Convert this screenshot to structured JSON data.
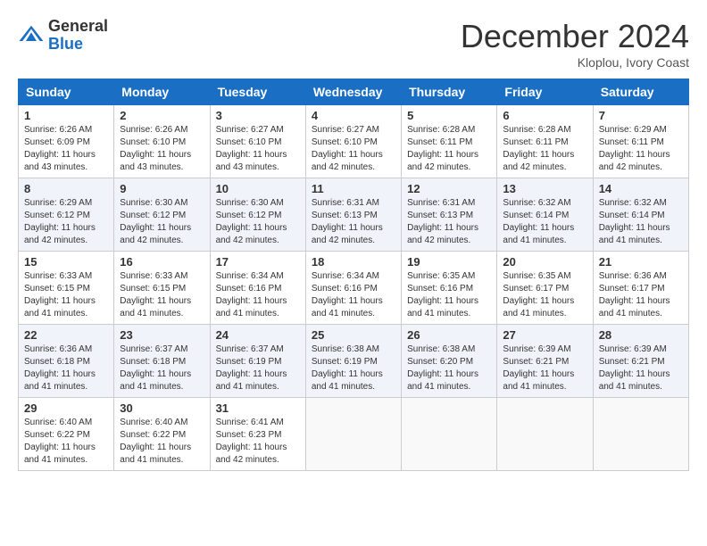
{
  "logo": {
    "general": "General",
    "blue": "Blue"
  },
  "title": "December 2024",
  "location": "Kloplou, Ivory Coast",
  "days_header": [
    "Sunday",
    "Monday",
    "Tuesday",
    "Wednesday",
    "Thursday",
    "Friday",
    "Saturday"
  ],
  "weeks": [
    [
      {
        "day": "1",
        "info": "Sunrise: 6:26 AM\nSunset: 6:09 PM\nDaylight: 11 hours and 43 minutes."
      },
      {
        "day": "2",
        "info": "Sunrise: 6:26 AM\nSunset: 6:10 PM\nDaylight: 11 hours and 43 minutes."
      },
      {
        "day": "3",
        "info": "Sunrise: 6:27 AM\nSunset: 6:10 PM\nDaylight: 11 hours and 43 minutes."
      },
      {
        "day": "4",
        "info": "Sunrise: 6:27 AM\nSunset: 6:10 PM\nDaylight: 11 hours and 42 minutes."
      },
      {
        "day": "5",
        "info": "Sunrise: 6:28 AM\nSunset: 6:11 PM\nDaylight: 11 hours and 42 minutes."
      },
      {
        "day": "6",
        "info": "Sunrise: 6:28 AM\nSunset: 6:11 PM\nDaylight: 11 hours and 42 minutes."
      },
      {
        "day": "7",
        "info": "Sunrise: 6:29 AM\nSunset: 6:11 PM\nDaylight: 11 hours and 42 minutes."
      }
    ],
    [
      {
        "day": "8",
        "info": "Sunrise: 6:29 AM\nSunset: 6:12 PM\nDaylight: 11 hours and 42 minutes."
      },
      {
        "day": "9",
        "info": "Sunrise: 6:30 AM\nSunset: 6:12 PM\nDaylight: 11 hours and 42 minutes."
      },
      {
        "day": "10",
        "info": "Sunrise: 6:30 AM\nSunset: 6:12 PM\nDaylight: 11 hours and 42 minutes."
      },
      {
        "day": "11",
        "info": "Sunrise: 6:31 AM\nSunset: 6:13 PM\nDaylight: 11 hours and 42 minutes."
      },
      {
        "day": "12",
        "info": "Sunrise: 6:31 AM\nSunset: 6:13 PM\nDaylight: 11 hours and 42 minutes."
      },
      {
        "day": "13",
        "info": "Sunrise: 6:32 AM\nSunset: 6:14 PM\nDaylight: 11 hours and 41 minutes."
      },
      {
        "day": "14",
        "info": "Sunrise: 6:32 AM\nSunset: 6:14 PM\nDaylight: 11 hours and 41 minutes."
      }
    ],
    [
      {
        "day": "15",
        "info": "Sunrise: 6:33 AM\nSunset: 6:15 PM\nDaylight: 11 hours and 41 minutes."
      },
      {
        "day": "16",
        "info": "Sunrise: 6:33 AM\nSunset: 6:15 PM\nDaylight: 11 hours and 41 minutes."
      },
      {
        "day": "17",
        "info": "Sunrise: 6:34 AM\nSunset: 6:16 PM\nDaylight: 11 hours and 41 minutes."
      },
      {
        "day": "18",
        "info": "Sunrise: 6:34 AM\nSunset: 6:16 PM\nDaylight: 11 hours and 41 minutes."
      },
      {
        "day": "19",
        "info": "Sunrise: 6:35 AM\nSunset: 6:16 PM\nDaylight: 11 hours and 41 minutes."
      },
      {
        "day": "20",
        "info": "Sunrise: 6:35 AM\nSunset: 6:17 PM\nDaylight: 11 hours and 41 minutes."
      },
      {
        "day": "21",
        "info": "Sunrise: 6:36 AM\nSunset: 6:17 PM\nDaylight: 11 hours and 41 minutes."
      }
    ],
    [
      {
        "day": "22",
        "info": "Sunrise: 6:36 AM\nSunset: 6:18 PM\nDaylight: 11 hours and 41 minutes."
      },
      {
        "day": "23",
        "info": "Sunrise: 6:37 AM\nSunset: 6:18 PM\nDaylight: 11 hours and 41 minutes."
      },
      {
        "day": "24",
        "info": "Sunrise: 6:37 AM\nSunset: 6:19 PM\nDaylight: 11 hours and 41 minutes."
      },
      {
        "day": "25",
        "info": "Sunrise: 6:38 AM\nSunset: 6:19 PM\nDaylight: 11 hours and 41 minutes."
      },
      {
        "day": "26",
        "info": "Sunrise: 6:38 AM\nSunset: 6:20 PM\nDaylight: 11 hours and 41 minutes."
      },
      {
        "day": "27",
        "info": "Sunrise: 6:39 AM\nSunset: 6:21 PM\nDaylight: 11 hours and 41 minutes."
      },
      {
        "day": "28",
        "info": "Sunrise: 6:39 AM\nSunset: 6:21 PM\nDaylight: 11 hours and 41 minutes."
      }
    ],
    [
      {
        "day": "29",
        "info": "Sunrise: 6:40 AM\nSunset: 6:22 PM\nDaylight: 11 hours and 41 minutes."
      },
      {
        "day": "30",
        "info": "Sunrise: 6:40 AM\nSunset: 6:22 PM\nDaylight: 11 hours and 41 minutes."
      },
      {
        "day": "31",
        "info": "Sunrise: 6:41 AM\nSunset: 6:23 PM\nDaylight: 11 hours and 42 minutes."
      },
      null,
      null,
      null,
      null
    ]
  ]
}
